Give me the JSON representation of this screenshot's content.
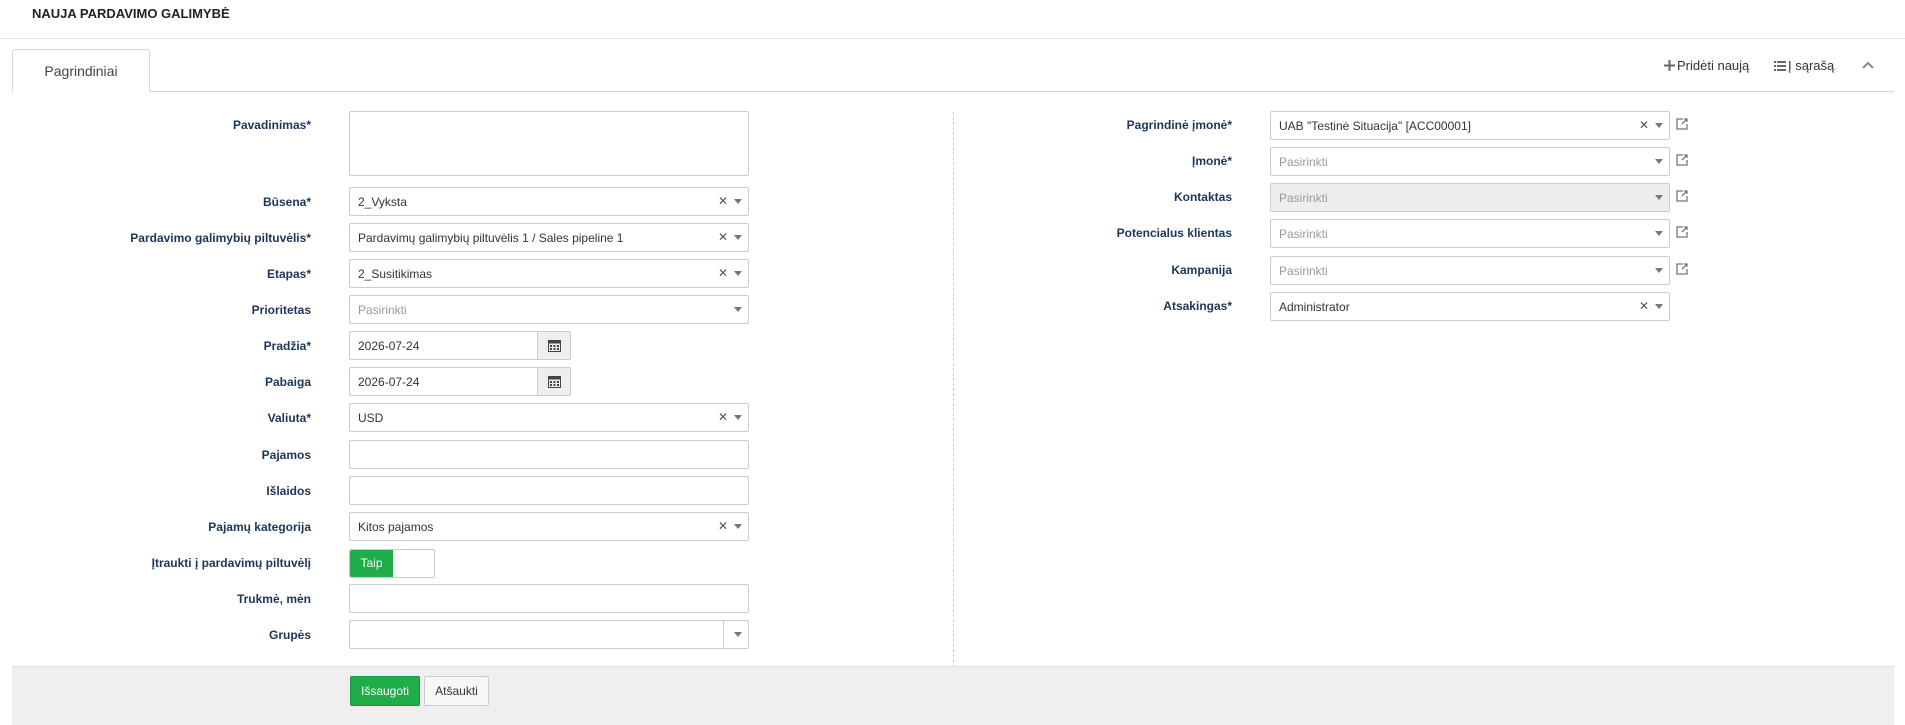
{
  "header": {
    "title": "NAUJA PARDAVIMO GALIMYBĖ"
  },
  "tabs": [
    {
      "label": "Pagrindiniai"
    }
  ],
  "toolbar": {
    "add_new": "Pridėti naują",
    "to_list": "Į sąrašą",
    "icons": {
      "add": "plus-icon",
      "list": "list-icon",
      "collapse": "chevron-up-icon"
    }
  },
  "left_form": {
    "name": {
      "label": "Pavadinimas*",
      "value": ""
    },
    "status": {
      "label": "Būsena*",
      "value": "2_Vyksta"
    },
    "pipeline": {
      "label": "Pardavimo galimybių piltuvėlis*",
      "value": "Pardavimų galimybių piltuvėlis 1 / Sales pipeline 1"
    },
    "stage": {
      "label": "Etapas*",
      "value": "2_Susitikimas"
    },
    "priority": {
      "label": "Prioritetas",
      "placeholder": "Pasirinkti"
    },
    "start": {
      "label": "Pradžia*",
      "value": "2026-07-24"
    },
    "end": {
      "label": "Pabaiga",
      "value": "2026-07-24"
    },
    "currency": {
      "label": "Valiuta*",
      "value": "USD"
    },
    "income": {
      "label": "Pajamos",
      "value": ""
    },
    "expenses": {
      "label": "Išlaidos",
      "value": ""
    },
    "income_category": {
      "label": "Pajamų kategorija",
      "value": "Kitos pajamos"
    },
    "include_pipeline": {
      "label": "Įtraukti į pardavimų piltuvėlį",
      "toggle_label": "Taip",
      "checked": true
    },
    "duration": {
      "label": "Trukmė, mėn",
      "value": ""
    },
    "groups": {
      "label": "Grupės",
      "value": ""
    }
  },
  "right_form": {
    "main_company": {
      "label": "Pagrindinė įmonė*",
      "value": "UAB \"Testinė Situacija\" [ACC00001]"
    },
    "company": {
      "label": "Įmonė*",
      "placeholder": "Pasirinkti"
    },
    "contact": {
      "label": "Kontaktas",
      "placeholder": "Pasirinkti"
    },
    "lead": {
      "label": "Potencialus klientas",
      "placeholder": "Pasirinkti"
    },
    "campaign": {
      "label": "Kampanija",
      "placeholder": "Pasirinkti"
    },
    "responsible": {
      "label": "Atsakingas*",
      "value": "Administrator"
    }
  },
  "actions": {
    "save": "Išsaugoti",
    "cancel": "Atšaukti"
  },
  "colors": {
    "primary": "#1fad4a",
    "label": "#1d3557"
  }
}
